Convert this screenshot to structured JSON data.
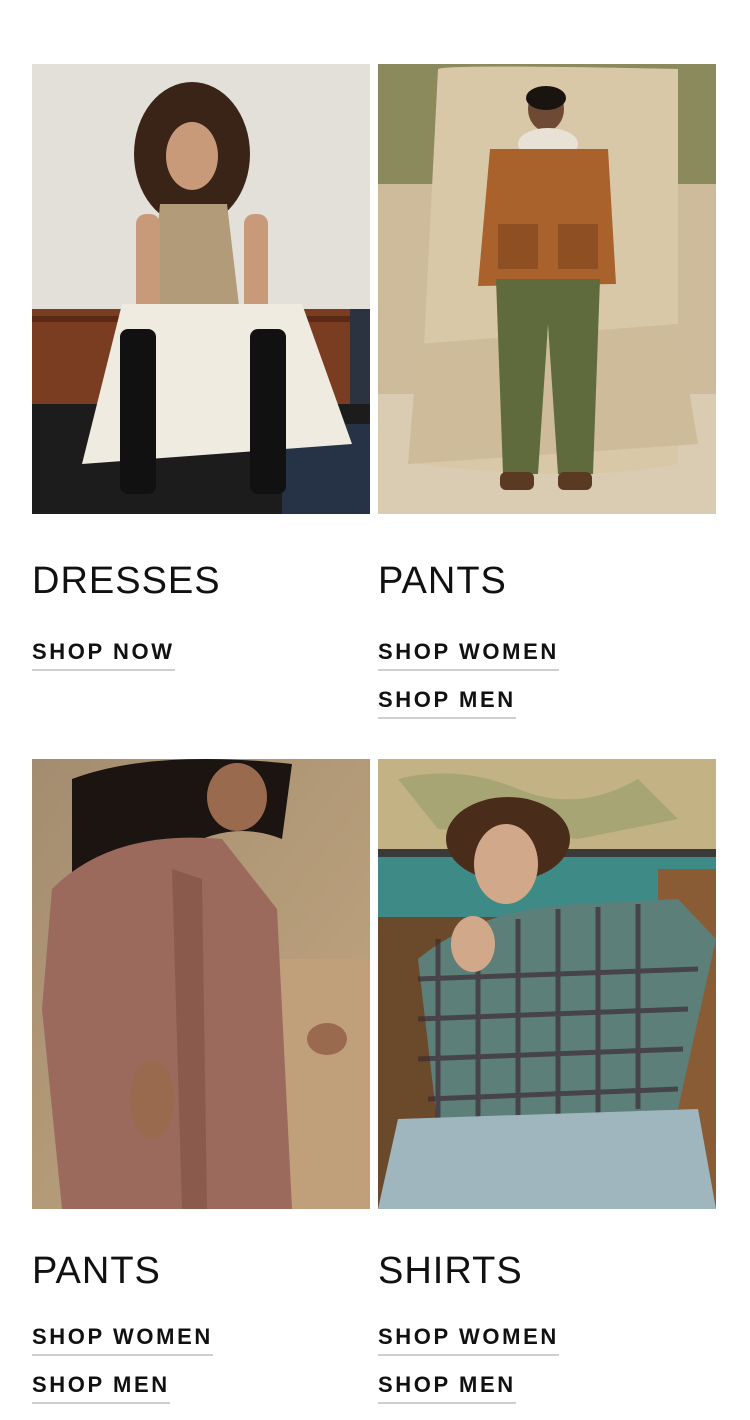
{
  "categories": [
    {
      "title": "DRESSES",
      "image_alt": "Woman with curly hair in a sleeveless knit vest, white skirt and tall black boots, seated on a bench",
      "links": [
        {
          "label": "SHOP NOW"
        }
      ]
    },
    {
      "title": "PANTS",
      "image_alt": "Man in a rust suede jacket and olive pants standing in front of a desert rock formation",
      "links": [
        {
          "label": "SHOP WOMEN"
        },
        {
          "label": "SHOP MEN"
        }
      ]
    },
    {
      "title": "PANTS",
      "image_alt": "Woman in a dusty rose linen shirt walking outdoors in warm light",
      "links": [
        {
          "label": "SHOP WOMEN"
        },
        {
          "label": "SHOP MEN"
        }
      ]
    },
    {
      "title": "SHIRTS",
      "image_alt": "Man with curly hair in a teal plaid shirt and light jeans seated in front of a wall map",
      "links": [
        {
          "label": "SHOP WOMEN"
        },
        {
          "label": "SHOP MEN"
        }
      ]
    }
  ]
}
